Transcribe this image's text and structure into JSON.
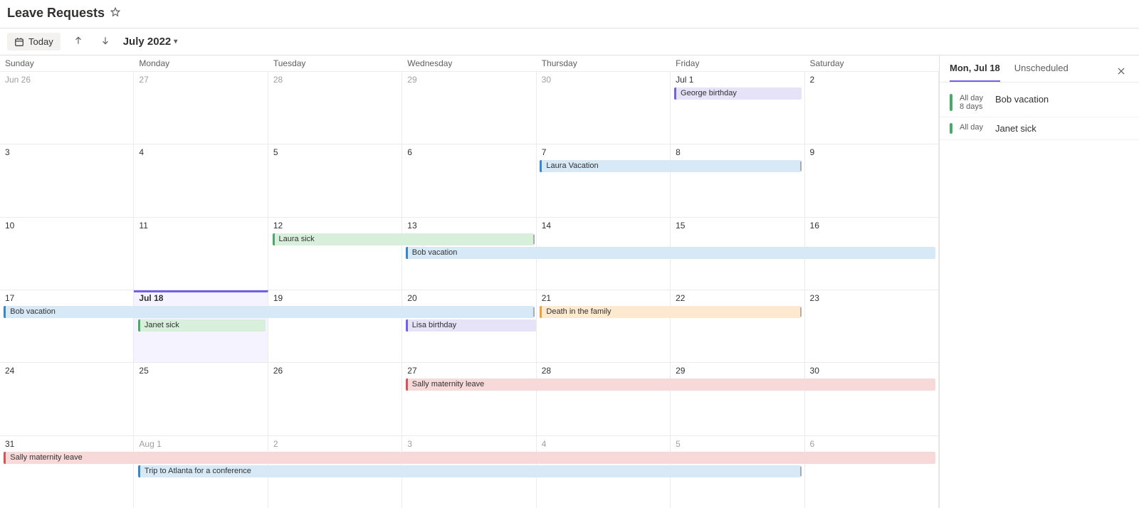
{
  "header": {
    "title": "Leave Requests"
  },
  "toolbar": {
    "today_label": "Today",
    "month_label": "July 2022"
  },
  "day_headers": [
    "Sunday",
    "Monday",
    "Tuesday",
    "Wednesday",
    "Thursday",
    "Friday",
    "Saturday"
  ],
  "weeks": [
    {
      "days": [
        "Jun 26",
        "27",
        "28",
        "29",
        "30",
        "Jul 1",
        "2"
      ],
      "other": [
        true,
        true,
        true,
        true,
        true,
        false,
        false
      ]
    },
    {
      "days": [
        "3",
        "4",
        "5",
        "6",
        "7",
        "8",
        "9"
      ],
      "other": [
        false,
        false,
        false,
        false,
        false,
        false,
        false
      ]
    },
    {
      "days": [
        "10",
        "11",
        "12",
        "13",
        "14",
        "15",
        "16"
      ],
      "other": [
        false,
        false,
        false,
        false,
        false,
        false,
        false
      ]
    },
    {
      "days": [
        "17",
        "Jul 18",
        "19",
        "20",
        "21",
        "22",
        "23"
      ],
      "other": [
        false,
        false,
        false,
        false,
        false,
        false,
        false
      ],
      "selected": 1
    },
    {
      "days": [
        "24",
        "25",
        "26",
        "27",
        "28",
        "29",
        "30"
      ],
      "other": [
        false,
        false,
        false,
        false,
        false,
        false,
        false
      ]
    },
    {
      "days": [
        "31",
        "Aug 1",
        "2",
        "3",
        "4",
        "5",
        "6"
      ],
      "other": [
        false,
        true,
        true,
        true,
        true,
        true,
        true
      ]
    }
  ],
  "events": {
    "george_birthday": "George birthday",
    "laura_vacation": "Laura Vacation",
    "laura_sick": "Laura sick",
    "bob_vacation_w3": "Bob vacation",
    "bob_vacation_w4": "Bob vacation",
    "janet_sick": "Janet sick",
    "lisa_birthday": "Lisa birthday",
    "death_family": "Death in the family",
    "sally_maternity_w5": "Sally maternity leave",
    "sally_maternity_w6": "Sally maternity leave",
    "trip_atlanta": "Trip to Atlanta for a conference"
  },
  "side": {
    "tab_date": "Mon, Jul 18",
    "tab_unscheduled": "Unscheduled",
    "items": [
      {
        "time1": "All day",
        "time2": "8 days",
        "title": "Bob vacation"
      },
      {
        "time1": "All day",
        "time2": "",
        "title": "Janet sick"
      }
    ]
  }
}
